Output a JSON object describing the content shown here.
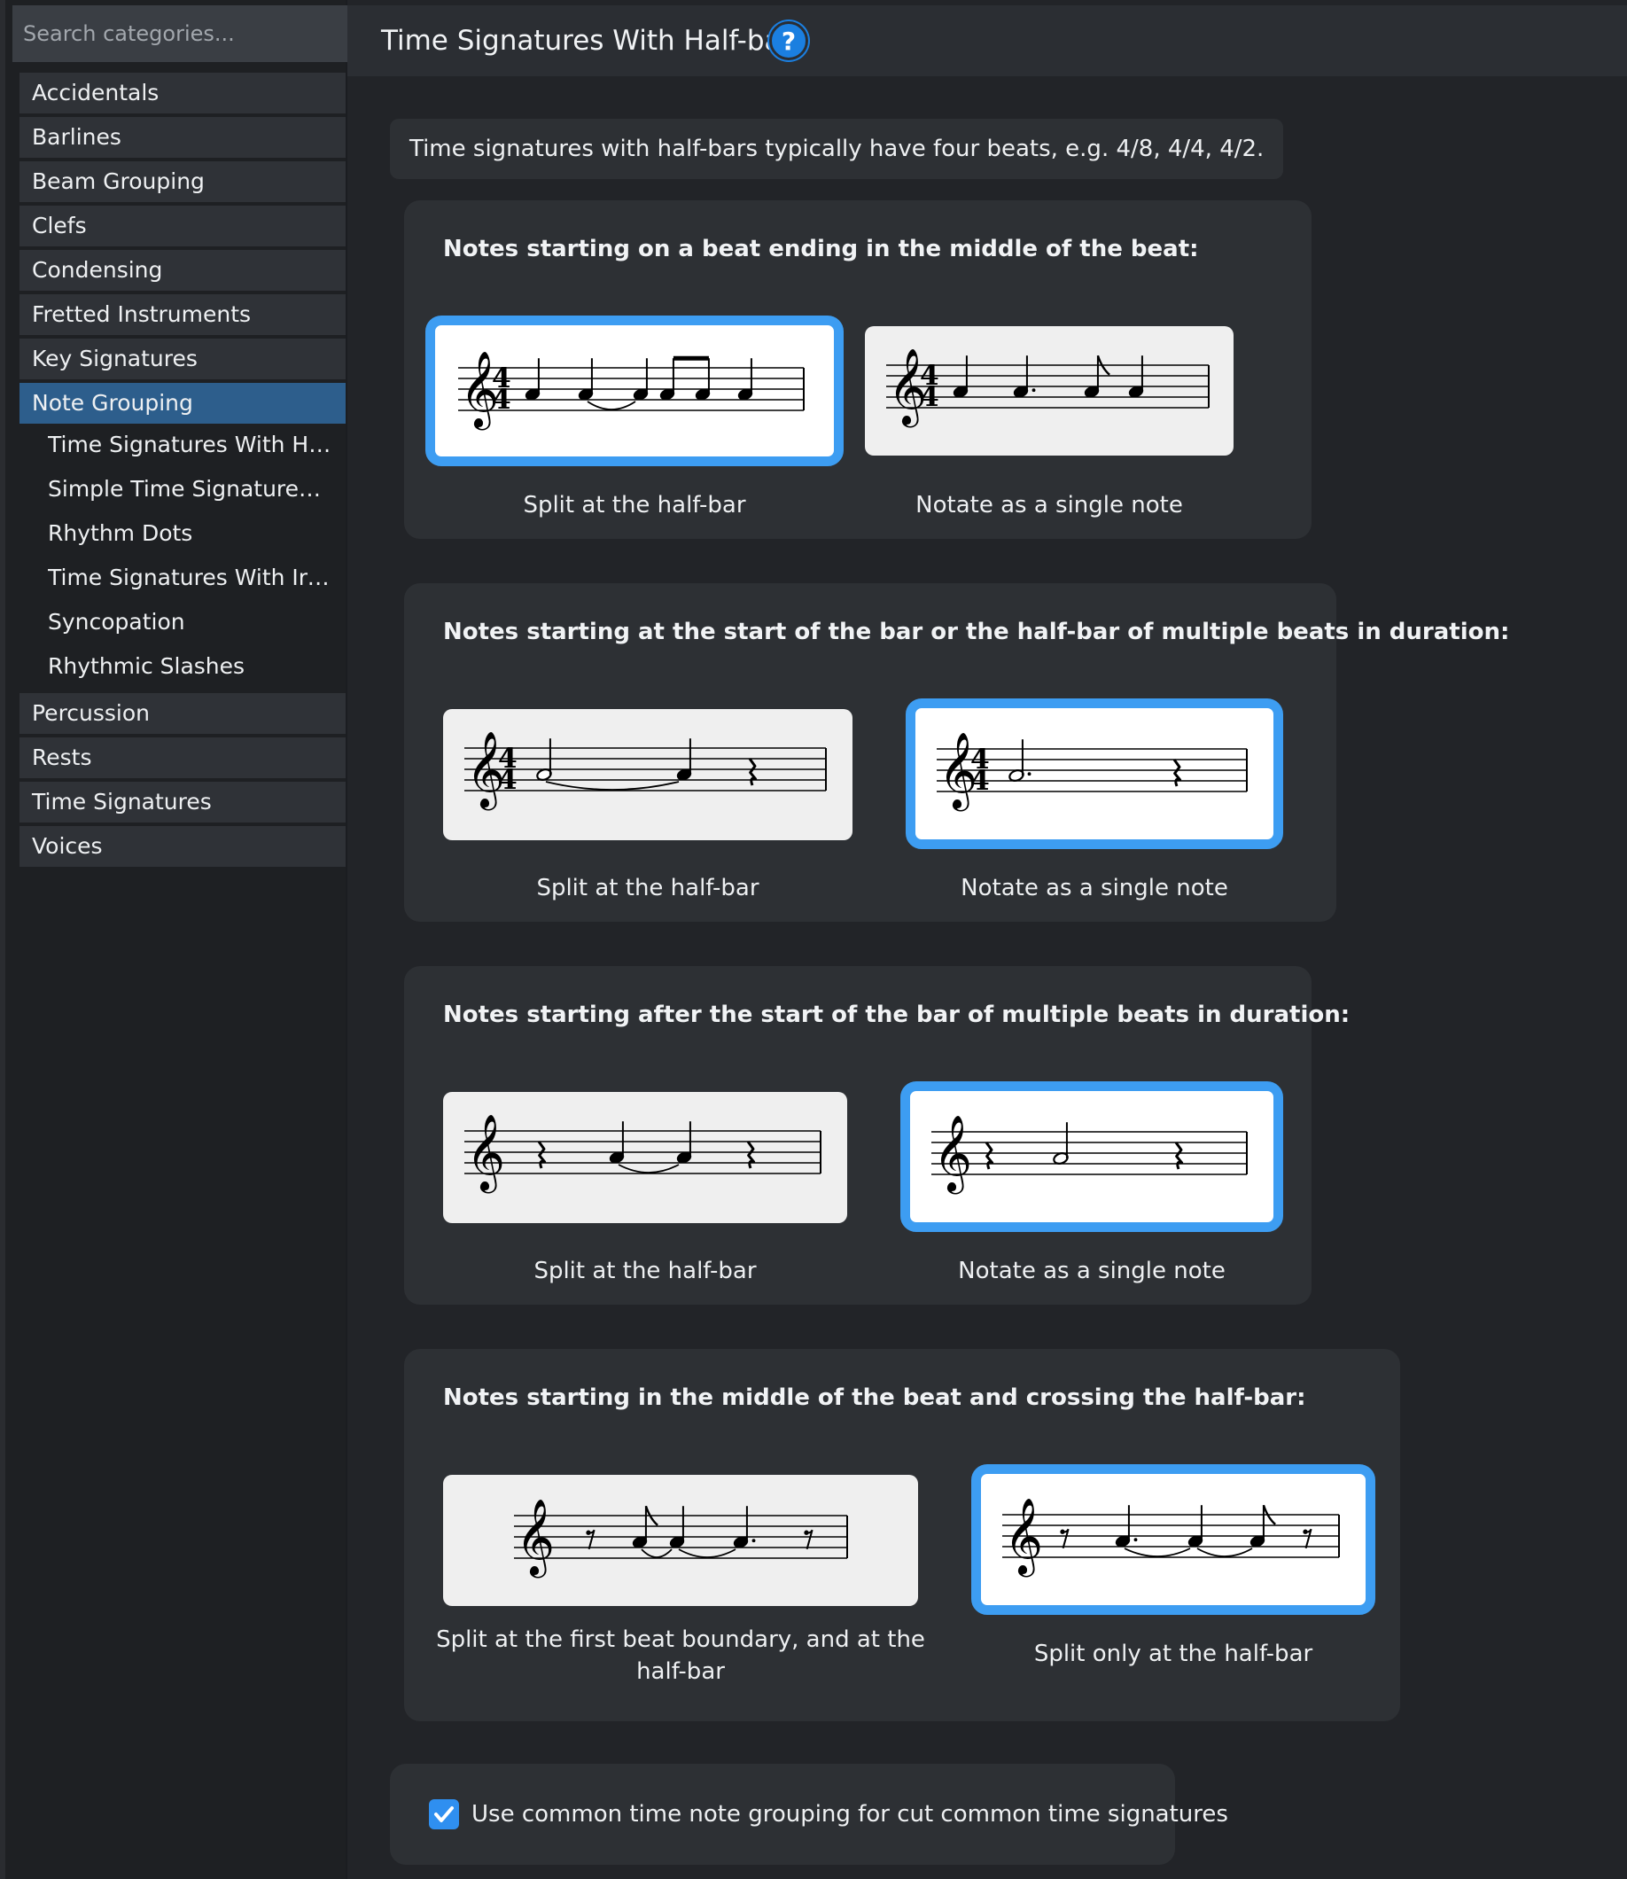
{
  "sidebar": {
    "search_placeholder": "Search categories...",
    "categories_top": [
      "Accidentals",
      "Barlines",
      "Beam Grouping",
      "Clefs",
      "Condensing",
      "Fretted Instruments",
      "Key Signatures"
    ],
    "active_category": "Note Grouping",
    "subcategories": [
      "Time Signatures With Hal…",
      "Simple Time Signatures W…",
      "Rhythm Dots",
      "Time Signatures With Irr…",
      "Syncopation",
      "Rhythmic Slashes"
    ],
    "categories_bottom": [
      "Percussion",
      "Rests",
      "Time Signatures",
      "Voices"
    ]
  },
  "header": {
    "title": "Time Signatures With Half-bars",
    "help_icon": "?"
  },
  "intro": "Time signatures with half-bars typically have four beats, e.g. 4/8, 4/4, 4/2.",
  "sections": [
    {
      "title": "Notes starting on a beat ending in the middle of the beat:",
      "options": [
        {
          "label": "Split at the half-bar",
          "selected": true
        },
        {
          "label": "Notate as a single note",
          "selected": false
        }
      ]
    },
    {
      "title": "Notes starting at the start of the bar or the half-bar of multiple beats in duration:",
      "options": [
        {
          "label": "Split at the half-bar",
          "selected": false
        },
        {
          "label": "Notate as a single note",
          "selected": true
        }
      ]
    },
    {
      "title": "Notes starting after the start of the bar of multiple beats in duration:",
      "options": [
        {
          "label": "Split at the half-bar",
          "selected": false
        },
        {
          "label": "Notate as a single note",
          "selected": true
        }
      ]
    },
    {
      "title": "Notes starting in the middle of the beat and crossing the half-bar:",
      "options": [
        {
          "label": "Split at the first beat boundary, and at the half-bar",
          "selected": false
        },
        {
          "label": "Split only at the half-bar",
          "selected": true
        }
      ]
    }
  ],
  "checkbox": {
    "label": "Use common time note grouping for cut common time signatures",
    "checked": true
  },
  "colors": {
    "accent": "#3d9df2",
    "active_category": "#2d5e8c",
    "help": "#1b7fe0"
  },
  "icons": {
    "help": "help-icon",
    "check": "checkmark-icon"
  }
}
